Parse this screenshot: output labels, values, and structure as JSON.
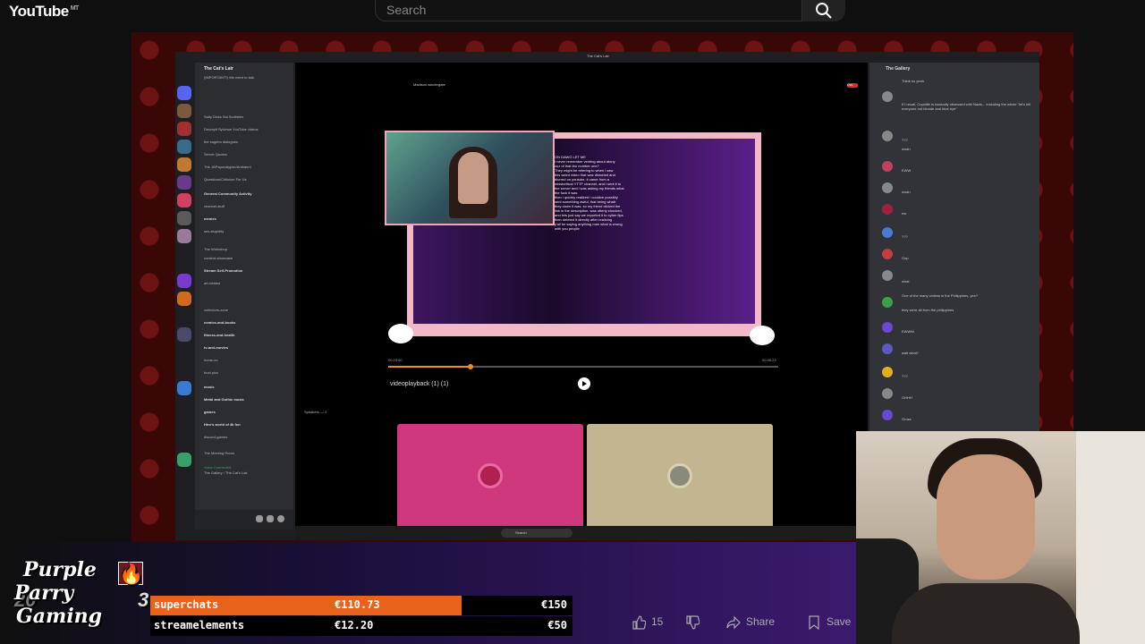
{
  "youtube": {
    "logo_text": "YouTube",
    "logo_sup": "MT",
    "search_placeholder": "Search"
  },
  "discord": {
    "window_title": "The Cat's Lair",
    "server_name": "The Cat's Lair",
    "channels": [
      "(IMPORTANT!) We need to talk.",
      "Salty Dicks Sal Scribbles",
      "Decrepit Sylvinoe YouTube videos",
      "the sagebo dialogues",
      "Server Quotes",
      "The JAPapocalypse/Antiranni",
      "Questions/Criticism For Us",
      "General Community Activity",
      "channel-stuff",
      "memes",
      "ses-stupidity",
      "The Workshop",
      "content-showcase",
      "Stream Self-Promotion",
      "art-related",
      "collectors-zone",
      "comics-and-books",
      "fitness-and-health",
      "tv-and-movies",
      "home-ec",
      "food pics",
      "music",
      "Metal and Gothic music",
      "games",
      "Hiro's world of 4k fun",
      "discord-games",
      "The Meeting Room"
    ],
    "voice_status": "Voice Connected",
    "voice_channel": "The Gallery / The Cat's Lair",
    "stage_title": "Madison windergate",
    "live_badge": "LIVE",
    "video_text": [
      "ON DAWG LET ME",
      "I never remember venting about atony",
      "cuz of that tho number one?",
      "They might be refering to when i saw",
      "this weird video that was distorted and",
      "blurred on youtube, it came from a",
      "misstcritical YTTP channel, and i sent it to",
      "the server and i was asking my friends what",
      "the fuck it was",
      "then i quickly realized i couldve possibly",
      "sent something awful, that being whatt",
      "they claim it was, so my friend clicked the",
      "link in the description. was utterly shocked,",
      "and lets just say we reported it to cyber tips",
      "then deleted it directly after realizing",
      "y'all be saying anything man what is wrong",
      "with you people"
    ],
    "player": {
      "title": "videoplayback (1) (1)",
      "time_current": "00:23:00",
      "time_total": "00:46:23",
      "progress": 0.21
    },
    "speakers_label": "Speakers — 2",
    "taskbar_search": "Search",
    "chat_title": "The Gallery",
    "chat": [
      "Think so yeah",
      "If I recall, Cupidite is basically obsessed with Nazis... including the whole \"let's kill everyone not blonde and blue eye\"",
      "???",
      "woah",
      "EWW",
      "woah",
      "ew",
      "???",
      "Oop",
      "what",
      "One of the many victims in the Philippines, yes?",
      "they were all from the philippines",
      "EWWW",
      "wait what?",
      "???",
      "OHHH",
      "Gross"
    ]
  },
  "overlay": {
    "logo_lines": [
      "Purple",
      "Parry",
      "Gaming"
    ],
    "logo_under": "20",
    "logo_num": "3",
    "bars": [
      {
        "label": "superchats",
        "amount": "€110.73",
        "goal": "€150",
        "progress": 0.738,
        "color": "#e8621b"
      },
      {
        "label": "streamelements",
        "amount": "€12.20",
        "goal": "€50",
        "progress": 0.0,
        "color": "#e8621b"
      }
    ]
  },
  "actions": {
    "like_count": "15",
    "share_label": "Share",
    "save_label": "Save"
  }
}
